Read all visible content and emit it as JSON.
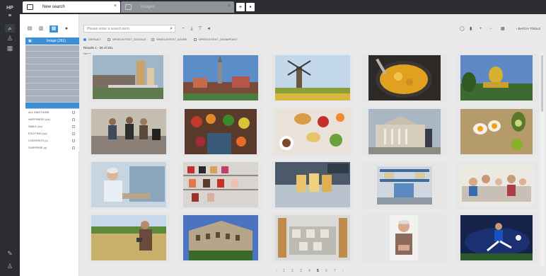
{
  "tabs": [
    {
      "label": "New search",
      "active": true
    },
    {
      "label": "Images",
      "active": false
    }
  ],
  "left_panel": {
    "header_label": "Image (261)",
    "filter_items": [
      "",
      "",
      "",
      "",
      "",
      "",
      "",
      "",
      "",
      "",
      ""
    ],
    "facets": [
      "ALL EMOTIONS",
      "HAPPINESS (xx)",
      "SMILE (xx)",
      "EXCITING (xx)",
      "CONTENTS (x)",
      "SURPRISE (x)"
    ]
  },
  "search": {
    "placeholder": "Please enter a search term"
  },
  "toolbar": {
    "batch_label": "BATCH TOOLS"
  },
  "filters": [
    "DEFAULT",
    "SPEECH/TEXT_GOOGLE",
    "SPEECH/TEXT_AZURE",
    "SPEECH/TEXT_SNOWPOINT"
  ],
  "results_label": "Results 1 - 20 of 261",
  "section_label": "Name",
  "images": [
    {
      "name": "city-bridge"
    },
    {
      "name": "old-town"
    },
    {
      "name": "windmill"
    },
    {
      "name": "curry-pan"
    },
    {
      "name": "golden-temple"
    },
    {
      "name": "street-musicians"
    },
    {
      "name": "market-fruits"
    },
    {
      "name": "breakfast-table"
    },
    {
      "name": "museum-square"
    },
    {
      "name": "eggs-avocado"
    },
    {
      "name": "elder-worker"
    },
    {
      "name": "shoe-shelves"
    },
    {
      "name": "bakery-counter"
    },
    {
      "name": "warehouse-racks"
    },
    {
      "name": "family-sofa"
    },
    {
      "name": "farmer-field"
    },
    {
      "name": "building-facade"
    },
    {
      "name": "storage-hall"
    },
    {
      "name": "older-man"
    },
    {
      "name": "soccer-player"
    }
  ],
  "pager": [
    "‹",
    "1",
    "2",
    "3",
    "4",
    "5",
    "6",
    "7",
    "›"
  ],
  "colors": {
    "accent": "#3a8fd6",
    "rail": "#2b2d33"
  }
}
